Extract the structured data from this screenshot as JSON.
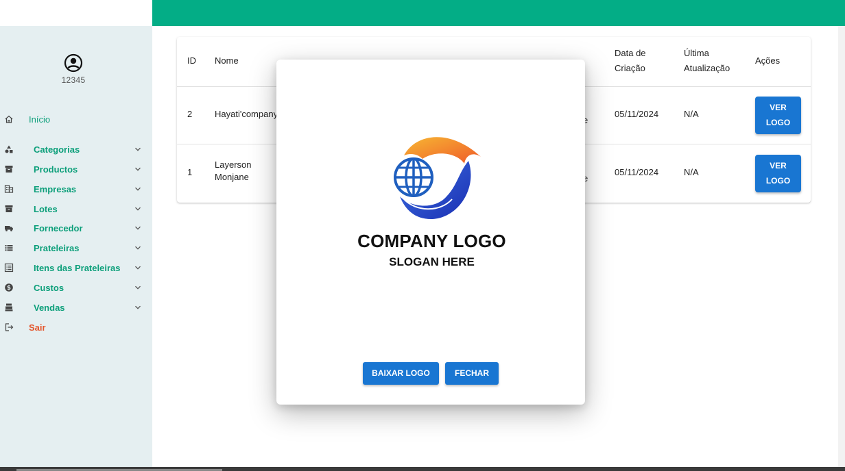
{
  "user": {
    "id": "12345"
  },
  "sidebar": {
    "items": [
      {
        "label": "Início",
        "icon": "home-icon",
        "type": "plain"
      },
      {
        "label": "Categorias",
        "icon": "shapes-icon",
        "type": "group"
      },
      {
        "label": "Productos",
        "icon": "archive-icon",
        "type": "group"
      },
      {
        "label": "Empresas",
        "icon": "building-icon",
        "type": "group"
      },
      {
        "label": "Lotes",
        "icon": "archive-icon",
        "type": "group"
      },
      {
        "label": "Fornecedor",
        "icon": "truck-icon",
        "type": "group"
      },
      {
        "label": "Prateleiras",
        "icon": "list-icon",
        "type": "group"
      },
      {
        "label": "Itens das Prateleiras",
        "icon": "list-alt-icon",
        "type": "group"
      },
      {
        "label": "Custos",
        "icon": "dollar-icon",
        "type": "group"
      },
      {
        "label": "Vendas",
        "icon": "register-icon",
        "type": "group"
      },
      {
        "label": "Sair",
        "icon": "logout-icon",
        "type": "danger"
      }
    ]
  },
  "table": {
    "headers": {
      "id": "ID",
      "nome": "Nome",
      "data_criacao_1": "Data de",
      "data_criacao_2": "Criação",
      "ultima_1": "Última",
      "ultima_2": "Atualização",
      "acoes": "Ações"
    },
    "rows": [
      {
        "id": "2",
        "nome_1": "Hayati'company",
        "nome_2": "",
        "partial": "e",
        "data": "05/11/2024",
        "ultima": "N/A",
        "btn_1": "VER",
        "btn_2": "LOGO"
      },
      {
        "id": "1",
        "nome_1": "Layerson",
        "nome_2": "Monjane",
        "partial": "e",
        "data": "05/11/2024",
        "ultima": "N/A",
        "btn_1": "VER",
        "btn_2": "LOGO"
      }
    ]
  },
  "modal": {
    "logo_title": "COMPANY LOGO",
    "logo_slogan": "SLOGAN HERE",
    "download_label": "BAIXAR LOGO",
    "close_label": "FECHAR"
  },
  "colors": {
    "topbar": "#03ad86",
    "sidebar_bg": "#e5eff1",
    "nav_text": "#0c9f7a",
    "logout_text": "#e4572e",
    "button": "#1976d2"
  }
}
